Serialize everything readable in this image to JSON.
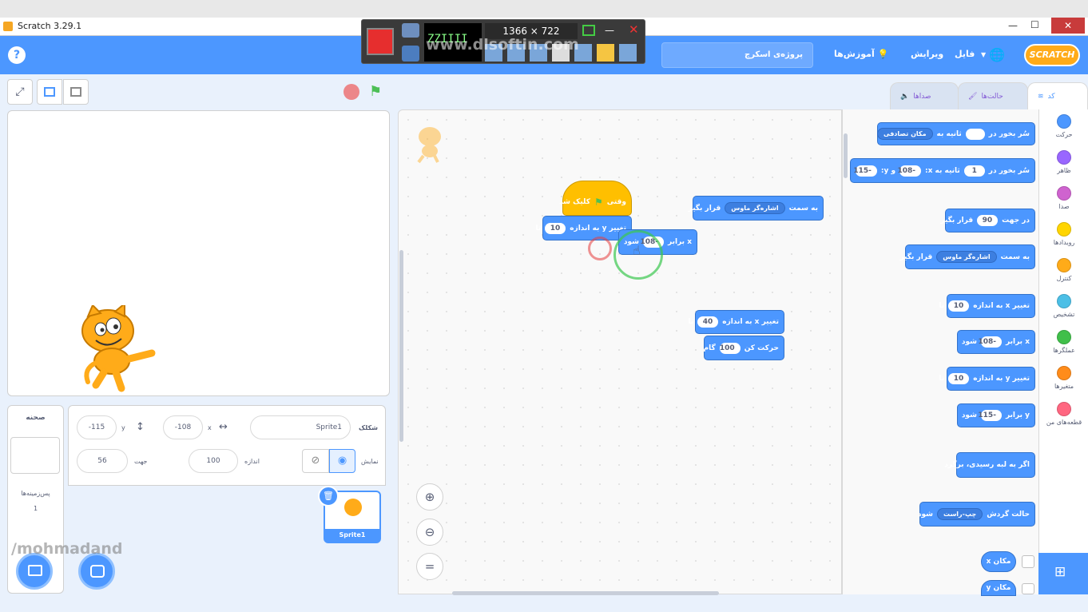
{
  "window": {
    "title": "Scratch 3.29.1",
    "min": "—",
    "max": "☐",
    "close": "✕"
  },
  "recorder": {
    "resolution": "1366 × 722",
    "watermark": "www.dlsoftin.com",
    "counter": "ZZIIII"
  },
  "menu": {
    "settings_label": "",
    "file": "فایل",
    "edit": "ویرایش",
    "tutorials": "آموزش‌ها",
    "project_title": "پروژه‌ی اسکرچ",
    "logo": "SCRATCH"
  },
  "tabs": {
    "code": "کد",
    "costumes": "حالت‌ها",
    "sounds": "صداها"
  },
  "categories": [
    {
      "label": "حرکت",
      "color": "#4c97ff"
    },
    {
      "label": "ظاهر",
      "color": "#9966ff"
    },
    {
      "label": "صدا",
      "color": "#cf63cf"
    },
    {
      "label": "رویدادها",
      "color": "#ffd500"
    },
    {
      "label": "کنترل",
      "color": "#ffab19"
    },
    {
      "label": "تشخیص",
      "color": "#4cbfe6"
    },
    {
      "label": "عملگرها",
      "color": "#40bf4a"
    },
    {
      "label": "متغیرها",
      "color": "#ff8c1a"
    },
    {
      "label": "قطعه‌های من",
      "color": "#ff6680"
    }
  ],
  "palette": {
    "glide_random": {
      "text1": "سُر بخور در",
      "text2": "ثانیه به",
      "dd": "مکان تصادفی"
    },
    "glide_xy": {
      "text1": "سُر بخور در",
      "v1": "1",
      "text2": "ثانیه به x:",
      "x": "-108",
      "text3": "و y:",
      "y": "-115"
    },
    "point_dir": {
      "text1": "در جهت",
      "v": "90",
      "text2": "قرار بگیر"
    },
    "point_towards": {
      "text1": "به سمت",
      "dd": "اشاره‌گر ماوس",
      "text2": "قرار بگیر"
    },
    "change_x": {
      "text1": "تغییر x به اندازه",
      "v": "10",
      "text2": "تا"
    },
    "set_x": {
      "text1": "x برابر",
      "v": "-108",
      "text2": "شود"
    },
    "change_y": {
      "text1": "تغییر y به اندازه",
      "v": "10",
      "text2": "تا"
    },
    "set_y": {
      "text1": "y برابر",
      "v": "-115",
      "text2": "شود"
    },
    "bounce": {
      "text": "اگر به لبه رسیدی، برگرد"
    },
    "rotation": {
      "text1": "حالت گردش",
      "dd": "چپ-راست",
      "text2": "شود"
    },
    "xpos": {
      "text": "مکان x"
    },
    "ypos": {
      "text": "مکان y"
    }
  },
  "script": {
    "hat": {
      "text1": "وقتی",
      "text2": "کلیک شد"
    },
    "change_y": {
      "text1": "تغییر y به اندازه",
      "v": "10",
      "text2": "تا"
    },
    "set_x": {
      "text1": "x برابر",
      "v": "-108",
      "text2": "شود"
    },
    "point_towards": {
      "text1": "به سمت",
      "dd": "اشاره‌گر ماوس",
      "text2": "قرار بگیر"
    },
    "change_x": {
      "text1": "تغییر x به اندازه",
      "v": "40",
      "text2": "تا"
    },
    "move": {
      "text1": "حرکت کن",
      "v": "100",
      "text2": "گام"
    }
  },
  "sprite_info": {
    "sprite_label": "شکلک",
    "sprite_name": "Sprite1",
    "x_label": "x",
    "x": "-108",
    "y_label": "y",
    "y": "-115",
    "show_label": "نمایش",
    "size_label": "اندازه",
    "size": "100",
    "direction_label": "جهت",
    "direction": "56"
  },
  "stage_panel": {
    "title": "صحنه",
    "backdrops_label": "پس‌زمینه‌ها",
    "backdrops_count": "1"
  },
  "sprite_tile": {
    "name": "Sprite1"
  },
  "watermark": "/mohmadand"
}
